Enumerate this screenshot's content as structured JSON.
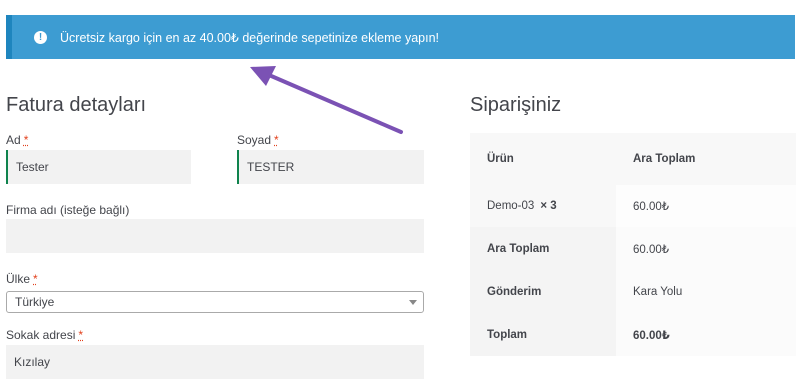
{
  "notice": {
    "message": "Ücretsiz kargo için en az 40.00₺ değerinde sepetinize ekleme yapın!",
    "icon": "info-icon",
    "color": "#3d9cd2"
  },
  "billing": {
    "title": "Fatura detayları",
    "first_name_label": "Ad",
    "first_name_value": "Tester",
    "last_name_label": "Soyad",
    "last_name_value": "TESTER",
    "company_label": "Firma adı (isteğe bağlı)",
    "company_value": "",
    "country_label": "Ülke",
    "country_value": "Türkiye",
    "street_label": "Sokak adresi",
    "street_value": "Kızılay",
    "required_mark": "*"
  },
  "order": {
    "title": "Siparişiniz",
    "col_product": "Ürün",
    "col_subtotal": "Ara Toplam",
    "item_name": "Demo-03",
    "item_qty": "× 3",
    "item_total": "60.00₺",
    "subtotal_label": "Ara Toplam",
    "subtotal_value": "60.00₺",
    "shipping_label": "Gönderim",
    "shipping_value": "Kara Yolu",
    "total_label": "Toplam",
    "total_value": "60.00₺"
  },
  "annotation": {
    "arrow_color": "#7b52b4"
  }
}
